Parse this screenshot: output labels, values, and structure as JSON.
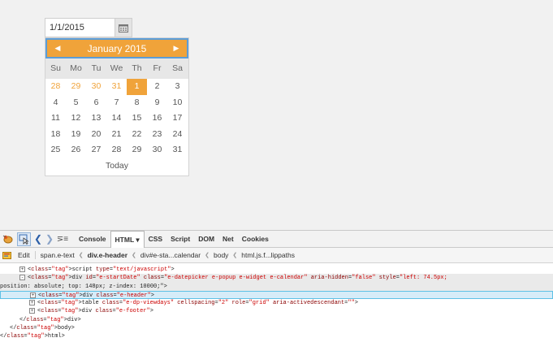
{
  "datepicker": {
    "value": "1/1/2015",
    "month_title": "January 2015",
    "weekdays": [
      "Su",
      "Mo",
      "Tu",
      "We",
      "Th",
      "Fr",
      "Sa"
    ],
    "weeks": [
      [
        "28",
        "29",
        "30",
        "31",
        "1",
        "2",
        "3"
      ],
      [
        "4",
        "5",
        "6",
        "7",
        "8",
        "9",
        "10"
      ],
      [
        "11",
        "12",
        "13",
        "14",
        "15",
        "16",
        "17"
      ],
      [
        "18",
        "19",
        "20",
        "21",
        "22",
        "23",
        "24"
      ],
      [
        "25",
        "26",
        "27",
        "28",
        "29",
        "30",
        "31"
      ]
    ],
    "other_month_cells": 4,
    "selected_day": "1",
    "footer": "Today",
    "accent": "#f0a33a",
    "focus_border": "#5b9dd9"
  },
  "devtools": {
    "tabs": [
      "Console",
      "HTML ▾",
      "CSS",
      "Script",
      "DOM",
      "Net",
      "Cookies"
    ],
    "active_tab": "HTML ▾",
    "edit_label": "Edit",
    "breadcrumbs": [
      "span.e-text",
      "div.e-header",
      "div#e-sta...calendar",
      "body",
      "html.js.f...lippaths"
    ],
    "bold_crumb": "div.e-header",
    "tree": [
      {
        "indent": 4,
        "twisty": "+",
        "html": "<script type=\"text/javascript\">"
      },
      {
        "indent": 4,
        "twisty": "-",
        "html": "<div id=\"e-startDate\" class=\"e-datepicker e-popup e-widget e-calendar\" aria-hidden=\"false\" style=\"left: 74.5px;",
        "highlight": true
      },
      {
        "indent": 0,
        "twisty": "",
        "html": "position: absolute; top: 148px; z-index: 10000;\">",
        "highlight": true
      },
      {
        "indent": 6,
        "twisty": "+",
        "html": "<div class=\"e-header\">",
        "selected": true
      },
      {
        "indent": 6,
        "twisty": "+",
        "html": "<table class=\"e-dp-viewdays\" cellspacing=\"2\" role=\"grid\" aria-activedescendant=\"\">"
      },
      {
        "indent": 6,
        "twisty": "+",
        "html": "<div class=\"e-footer\">"
      },
      {
        "indent": 4,
        "twisty": "",
        "html": "</div>"
      },
      {
        "indent": 2,
        "twisty": "",
        "html": "</body>"
      },
      {
        "indent": 0,
        "twisty": "",
        "html": "</html>"
      }
    ]
  }
}
